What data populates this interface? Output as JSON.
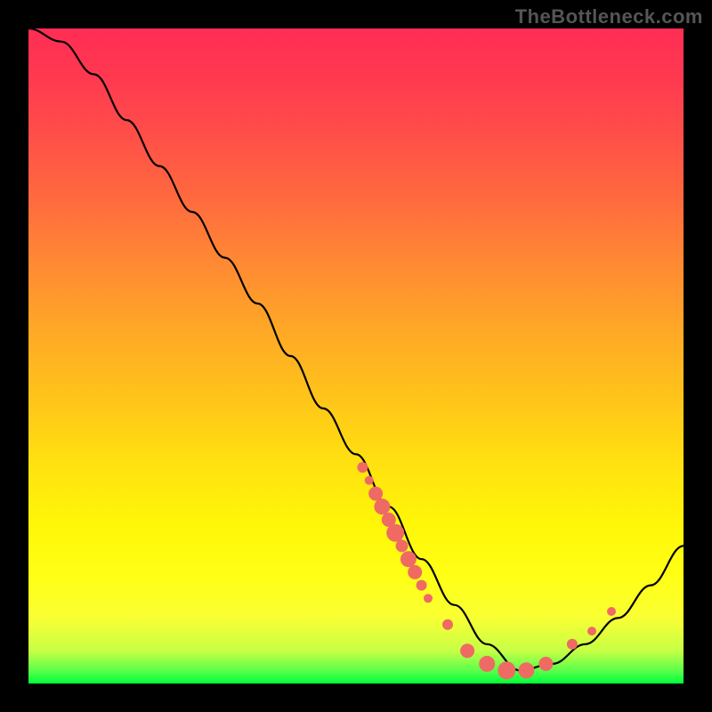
{
  "watermark": "TheBottleneck.com",
  "chart_data": {
    "type": "line",
    "title": "",
    "xlabel": "",
    "ylabel": "",
    "ylim": [
      0,
      100
    ],
    "xlim": [
      0,
      100
    ],
    "legend": false,
    "grid": false,
    "series": [
      {
        "name": "bottleneck-curve",
        "color": "#000000",
        "_comment": "Values estimated from curve geometry on an implicit 0-100 y axis where 0 is bottom (green) and 100 is top (red). Shape: roughly a tilted V with minimum near x≈75, right tail rises again.",
        "x": [
          0,
          5,
          10,
          15,
          20,
          25,
          30,
          35,
          40,
          45,
          50,
          55,
          60,
          65,
          70,
          75,
          80,
          85,
          90,
          95,
          100
        ],
        "values": [
          100,
          98,
          93,
          86,
          79,
          72,
          65,
          58,
          50,
          42,
          35,
          27,
          19,
          12,
          6,
          2,
          3,
          6,
          10,
          15,
          21
        ]
      }
    ],
    "markers": {
      "name": "scatter-dots",
      "color": "#ef6a63",
      "_comment": "Salmon-colored dots roughly tracking the lower portion of the curve; sizes vary (r in px, relative).",
      "points": [
        {
          "x": 51,
          "y": 33,
          "r": 6
        },
        {
          "x": 52,
          "y": 31,
          "r": 5
        },
        {
          "x": 53,
          "y": 29,
          "r": 8
        },
        {
          "x": 54,
          "y": 27,
          "r": 9
        },
        {
          "x": 55,
          "y": 25,
          "r": 8
        },
        {
          "x": 56,
          "y": 23,
          "r": 10
        },
        {
          "x": 57,
          "y": 21,
          "r": 7
        },
        {
          "x": 58,
          "y": 19,
          "r": 9
        },
        {
          "x": 59,
          "y": 17,
          "r": 8
        },
        {
          "x": 60,
          "y": 15,
          "r": 6
        },
        {
          "x": 61,
          "y": 13,
          "r": 5
        },
        {
          "x": 64,
          "y": 9,
          "r": 6
        },
        {
          "x": 67,
          "y": 5,
          "r": 8
        },
        {
          "x": 70,
          "y": 3,
          "r": 9
        },
        {
          "x": 73,
          "y": 2,
          "r": 10
        },
        {
          "x": 76,
          "y": 2,
          "r": 9
        },
        {
          "x": 79,
          "y": 3,
          "r": 8
        },
        {
          "x": 83,
          "y": 6,
          "r": 6
        },
        {
          "x": 86,
          "y": 8,
          "r": 5
        },
        {
          "x": 89,
          "y": 11,
          "r": 5
        }
      ]
    }
  }
}
